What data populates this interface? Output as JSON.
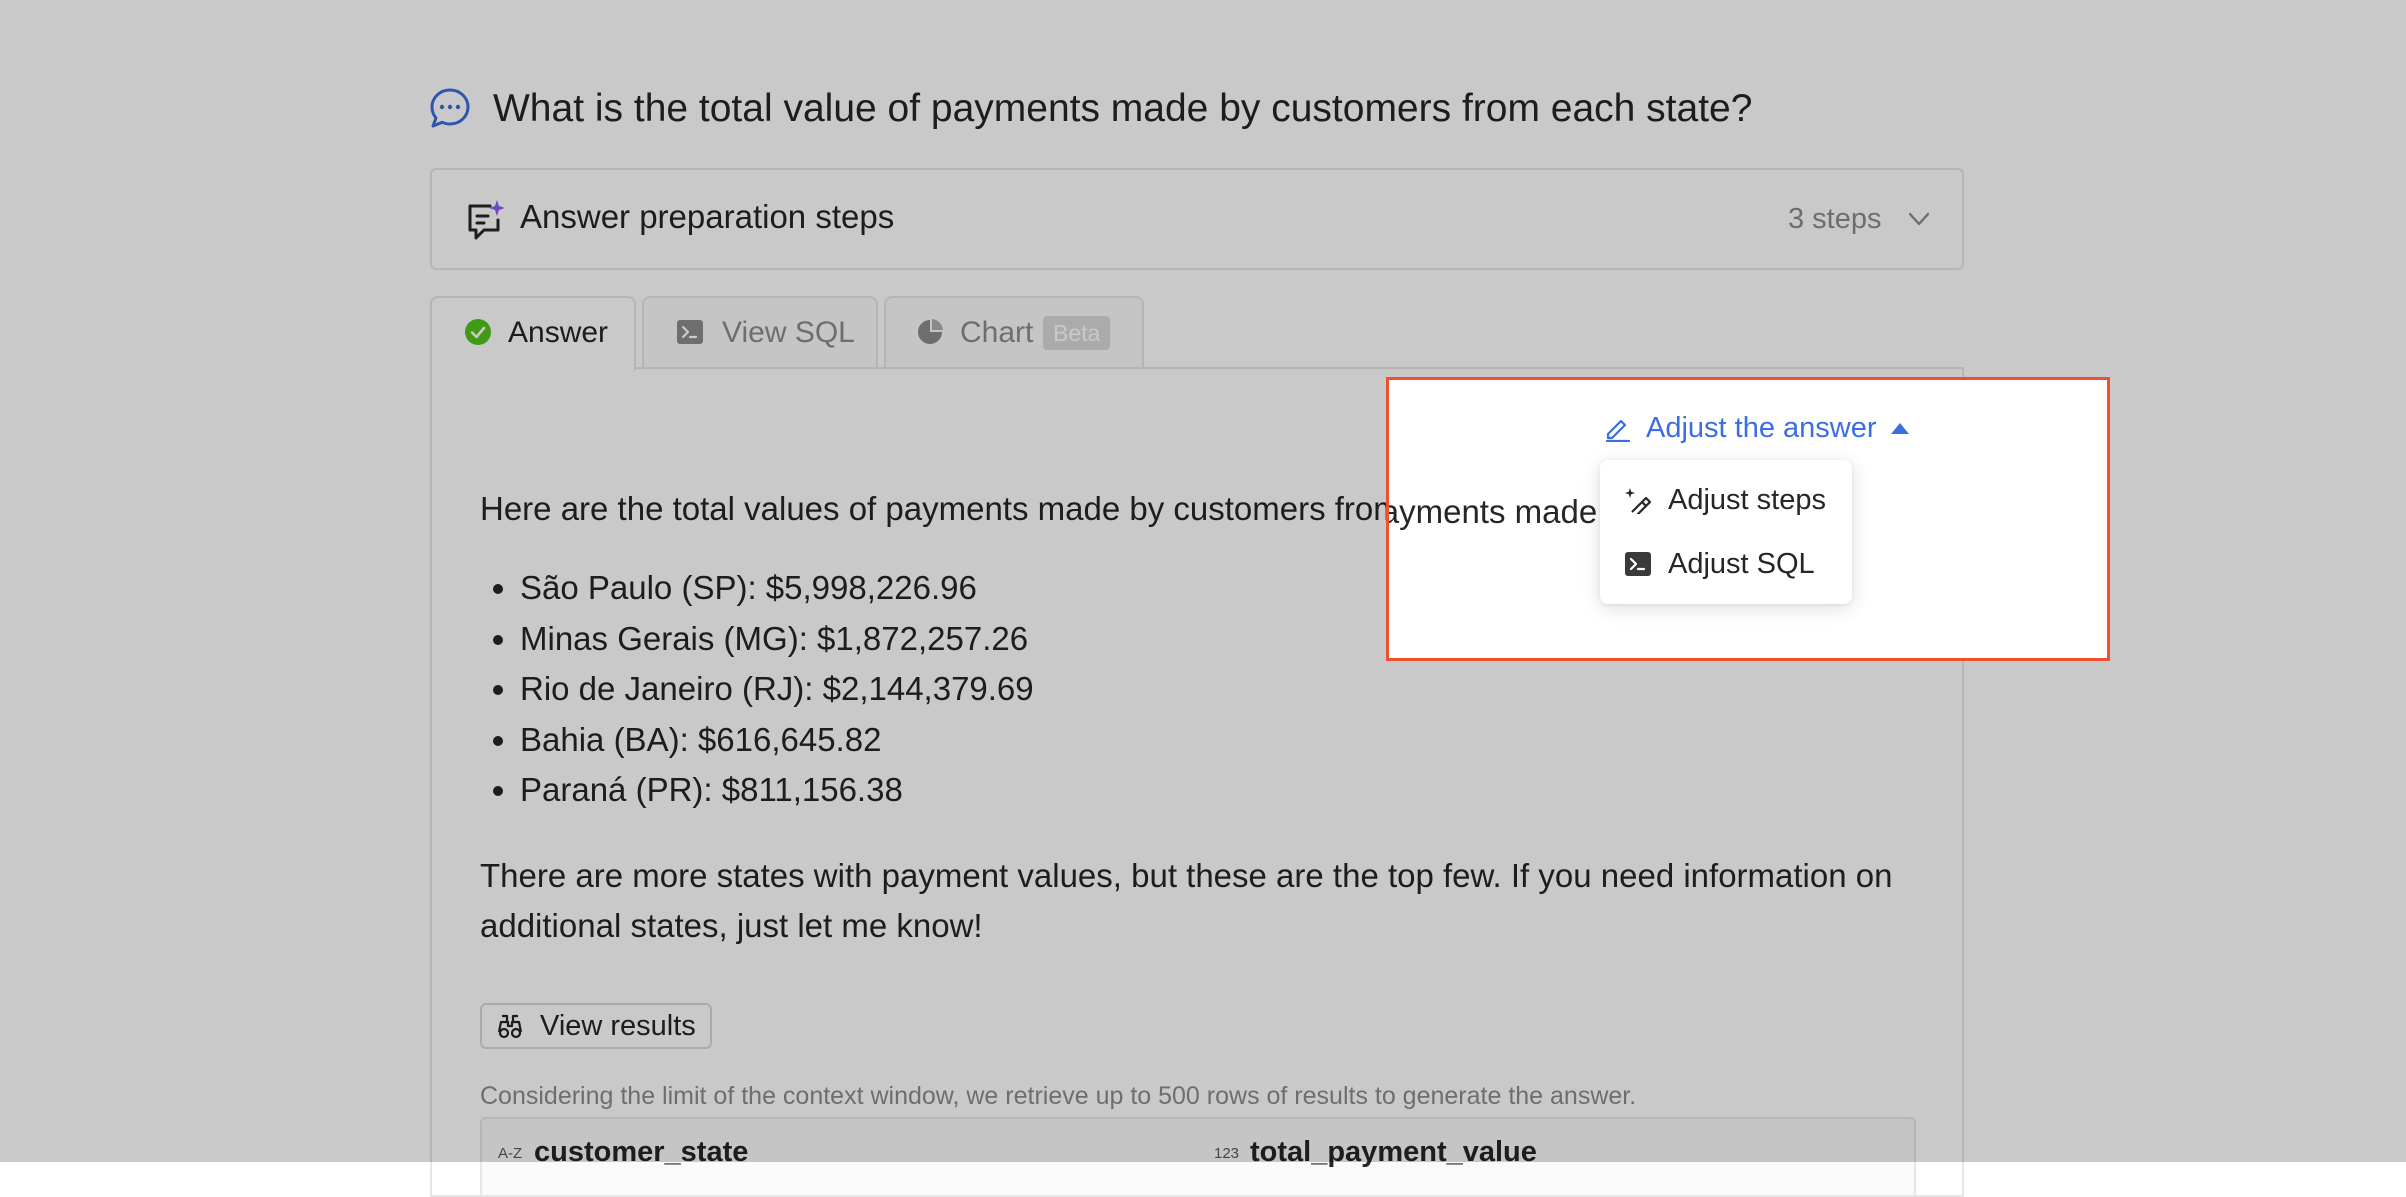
{
  "question": {
    "title": "What is the total value of payments made by customers from each state?"
  },
  "steps_panel": {
    "label": "Answer preparation steps",
    "count": "3 steps"
  },
  "tabs": [
    {
      "label": "Answer",
      "active": true
    },
    {
      "label": "View SQL",
      "active": false
    },
    {
      "label": "Chart",
      "badge": "Beta",
      "active": false
    }
  ],
  "answer": {
    "intro": "Here are the total values of payments made by customers from various states",
    "bullets": [
      "São Paulo (SP): $5,998,226.96",
      "Minas Gerais (MG): $1,872,257.26",
      "Rio de Janeiro (RJ): $2,144,379.69",
      "Bahia (BA): $616,645.82",
      "Paraná (PR): $811,156.38"
    ],
    "outro": "There are more states with payment values, but these are the top few. If you need information on additional states, just let me know!"
  },
  "results": {
    "button_label": "View results",
    "note": "Considering the limit of the context window, we retrieve up to 500 rows of results to generate the answer.",
    "columns": [
      {
        "type": "A-Z",
        "name": "customer_state"
      },
      {
        "type": "123",
        "name": "total_payment_value"
      }
    ]
  },
  "adjust": {
    "label": "Adjust the answer",
    "menu": [
      {
        "label": "Adjust steps",
        "icon": "magic-wand-icon"
      },
      {
        "label": "Adjust SQL",
        "icon": "terminal-icon"
      }
    ]
  },
  "colors": {
    "accent": "#3b6ee0",
    "highlight_border": "#f0502f",
    "success": "#52c41a",
    "sparkle": "#8b5cf6"
  }
}
